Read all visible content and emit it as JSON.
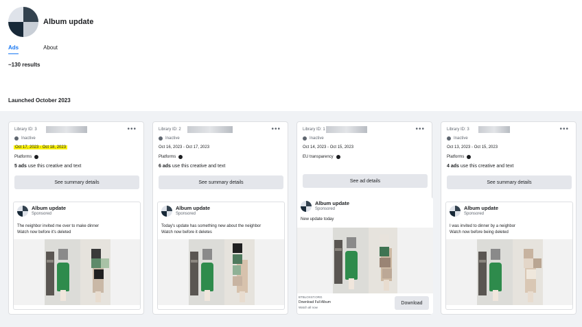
{
  "header": {
    "page_name": "Album update",
    "tabs": [
      {
        "label": "Ads",
        "active": true
      },
      {
        "label": "About",
        "active": false
      }
    ],
    "results": "~130 results"
  },
  "section_label": "Launched October 2023",
  "cards": [
    {
      "library_label": "Library ID: 3",
      "status": "Inactive",
      "dates": "Oct 17, 2023 - Oct 18, 2023",
      "dates_highlighted": true,
      "platforms_label": "Platforms",
      "ads_count_bold": "5 ads",
      "ads_count_rest": " use this creative and text",
      "button_label": "See summary details",
      "preview": {
        "name": "Album update",
        "sponsored": "Sponsored",
        "text_line1": "The neighbor invited me over to make dinner",
        "text_line2": "Watch now before it's deleted"
      }
    },
    {
      "library_label": "Library ID: 2",
      "status": "Inactive",
      "dates": "Oct 16, 2023 - Oct 17, 2023",
      "dates_highlighted": false,
      "platforms_label": "Platforms",
      "ads_count_bold": "6 ads",
      "ads_count_rest": " use this creative and text",
      "button_label": "See summary details",
      "preview": {
        "name": "Album update",
        "sponsored": "Sponsored",
        "text_line1": "Today's update has something new about the neighbor",
        "text_line2": "Watch now before it deletes"
      }
    },
    {
      "library_label": "Library ID: 1",
      "status": "Inactive",
      "dates": "Oct 14, 2023 - Oct 15, 2023",
      "dates_highlighted": false,
      "platforms_label": "EU transparency",
      "button_label": "See ad details",
      "preview": {
        "name": "Album update",
        "sponsored": "Sponsored",
        "text_line1": "New update today",
        "foot_url": "BTBLOXST.ORG",
        "foot_title": "Download Full Album",
        "foot_sub": "Watch all now",
        "download_label": "Download"
      }
    },
    {
      "library_label": "Library ID: 3",
      "status": "Inactive",
      "dates": "Oct 13, 2023 - Oct 15, 2023",
      "dates_highlighted": false,
      "platforms_label": "Platforms",
      "ads_count_bold": "4 ads",
      "ads_count_rest": " use this creative and text",
      "button_label": "See summary details",
      "preview": {
        "name": "Album update",
        "sponsored": "Sponsored",
        "text_line1": "I was invited to dinner by a neighbor",
        "text_line2": "Watch now before being deleted"
      }
    }
  ],
  "more_icon": "more-options-icon",
  "colors": {
    "accent": "#1877f2",
    "highlight": "#fbf20d",
    "background": "#f0f2f5"
  }
}
